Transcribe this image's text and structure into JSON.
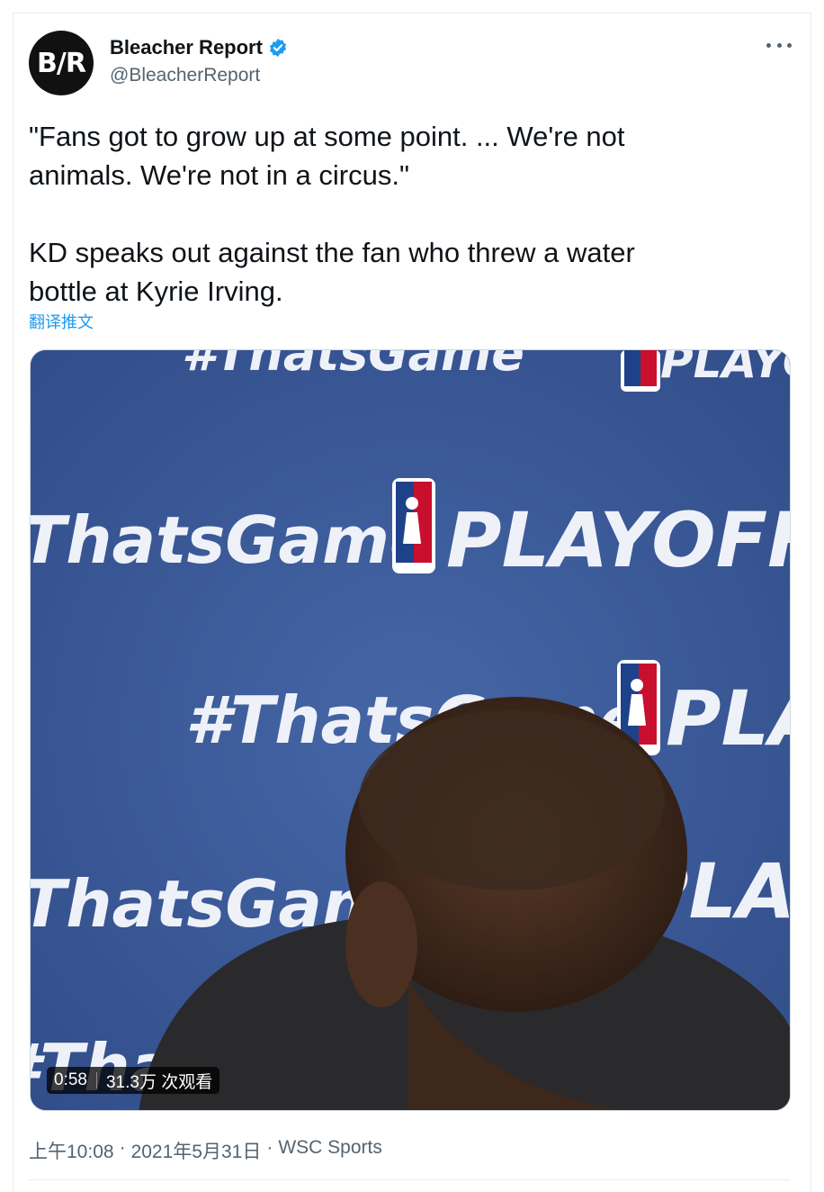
{
  "author": {
    "avatar_text": "B/R",
    "name": "Bleacher Report",
    "handle": "@BleacherReport",
    "verified": true
  },
  "icons": {
    "verified": "verified-badge-icon",
    "more": "more-options-icon"
  },
  "tweet": {
    "text": "\"Fans got to grow up at some point. ... We're not\nanimals. We're not in a circus.\"\n\nKD speaks out against the fan who threw a water\nbottle at Kyrie Irving.",
    "translate_label": "翻译推文"
  },
  "media": {
    "backdrop_texts": [
      "#ThatsGame",
      "PLAYOFFS",
      "NBA"
    ],
    "duration": "0:58",
    "views": "31.3万 次观看"
  },
  "meta": {
    "time": "上午10:08",
    "separator": "·",
    "date": "2021年5月31日",
    "source": "WSC Sports"
  },
  "colors": {
    "accent": "#1d9bf0",
    "secondary_text": "#536471",
    "backdrop_blue": "#3a5896"
  }
}
